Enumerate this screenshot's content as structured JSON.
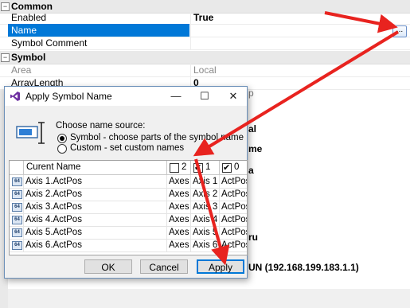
{
  "property_grid": {
    "categories": [
      {
        "label": "Common",
        "expander": "−"
      },
      {
        "label": "Symbol",
        "expander": "−"
      }
    ],
    "rows": [
      {
        "key": "Enabled",
        "value": "True"
      },
      {
        "key": "Name",
        "value": ""
      },
      {
        "key": "Symbol Comment",
        "value": ""
      },
      {
        "key": "Area",
        "value": "Local"
      },
      {
        "key": "ArrayLength",
        "value": "0"
      }
    ],
    "ellipsis_label": "...",
    "background_fragments": [
      "p",
      "al",
      "me",
      "a",
      "ru",
      "UN (192.168.199.183.1.1)"
    ]
  },
  "dialog": {
    "title": "Apply Symbol Name",
    "title_buttons": {
      "minimize": "—",
      "maximize": "☐",
      "close": "✕"
    },
    "choose_label": "Choose name source:",
    "options": [
      {
        "label": "Symbol - choose parts of the symbol name",
        "selected": true
      },
      {
        "label": "Custom - set custom names",
        "selected": false
      }
    ],
    "table": {
      "headers": {
        "name": "Curent Name",
        "col2": "2",
        "col1": "1",
        "col0": "0"
      },
      "header_checks": {
        "col2": false,
        "col1": true,
        "col0": true
      },
      "rows": [
        {
          "name": "Axis 1.ActPos",
          "c2": "Axes",
          "c1": "Axis 1",
          "c0": "ActPos"
        },
        {
          "name": "Axis 2.ActPos",
          "c2": "Axes",
          "c1": "Axis 2",
          "c0": "ActPos"
        },
        {
          "name": "Axis 3.ActPos",
          "c2": "Axes",
          "c1": "Axis 3",
          "c0": "ActPos"
        },
        {
          "name": "Axis 4.ActPos",
          "c2": "Axes",
          "c1": "Axis 4",
          "c0": "ActPos"
        },
        {
          "name": "Axis 5.ActPos",
          "c2": "Axes",
          "c1": "Axis 5",
          "c0": "ActPos"
        },
        {
          "name": "Axis 6.ActPos",
          "c2": "Axes",
          "c1": "Axis 6",
          "c0": "ActPos"
        }
      ],
      "row_icon_text": "64"
    },
    "buttons": {
      "ok": "OK",
      "cancel": "Cancel",
      "apply": "Apply"
    }
  },
  "colors": {
    "selection": "#0078d7",
    "arrow": "#e8231f"
  }
}
